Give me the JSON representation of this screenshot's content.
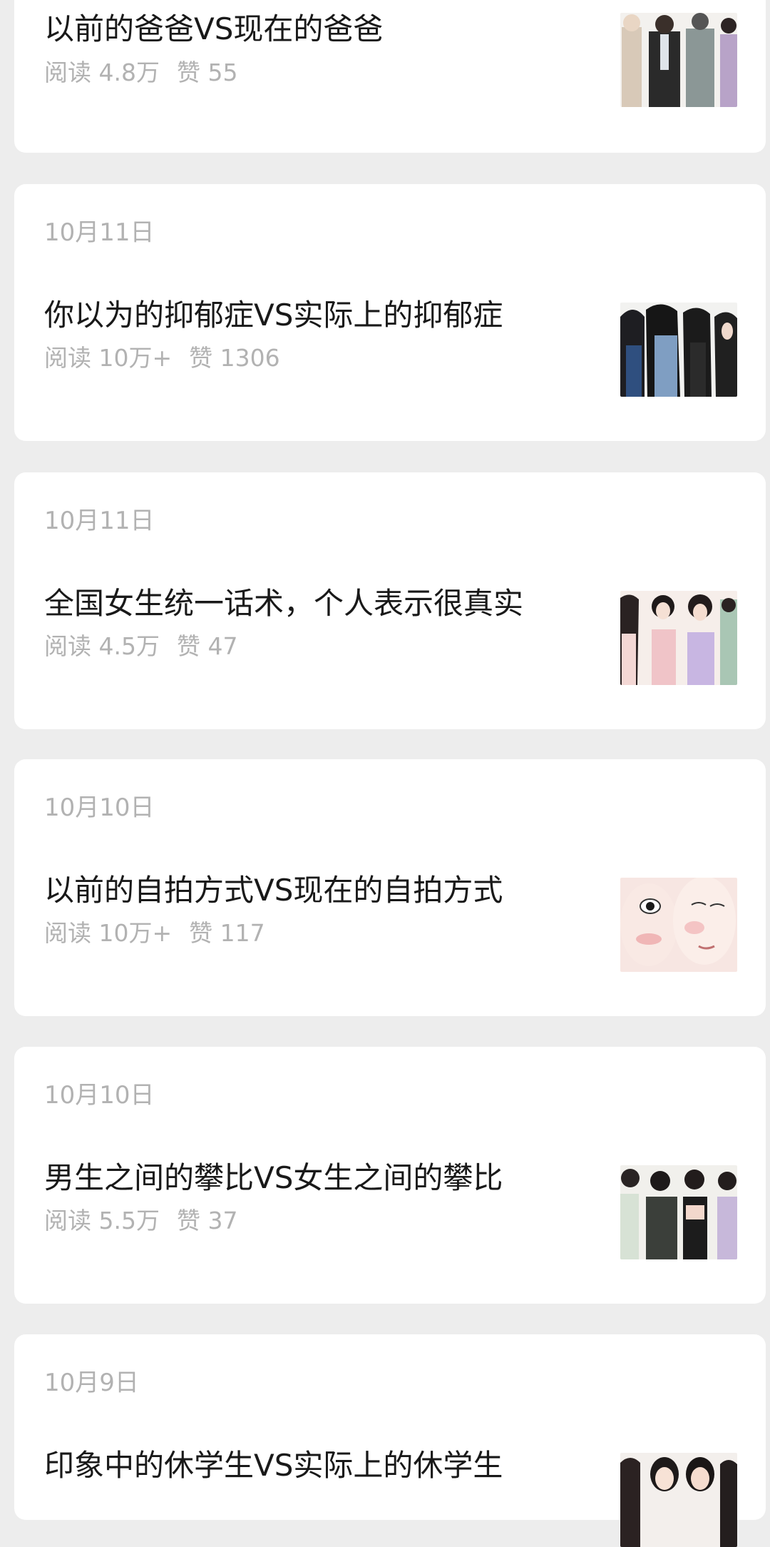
{
  "articles": [
    {
      "date": "",
      "title": "以前的爸爸VS现在的爸爸",
      "reads": "阅读 4.8万",
      "likes": "赞 55",
      "thumb_icon": "illustration-fathers-thumbnail"
    },
    {
      "date": "10月11日",
      "title": "你以为的抑郁症VS实际上的抑郁症",
      "reads": "阅读 10万+",
      "likes": "赞 1306",
      "thumb_icon": "illustration-women-dark-hair-thumbnail"
    },
    {
      "date": "10月11日",
      "title": "全国女生统一话术，个人表示很真实",
      "reads": "阅读 4.5万",
      "likes": "赞 47",
      "thumb_icon": "illustration-women-group-thumbnail"
    },
    {
      "date": "10月10日",
      "title": "以前的自拍方式VS现在的自拍方式",
      "reads": "阅读 10万+",
      "likes": "赞 117",
      "thumb_icon": "illustration-selfie-faces-thumbnail"
    },
    {
      "date": "10月10日",
      "title": "男生之间的攀比VS女生之间的攀比",
      "reads": "阅读 5.5万",
      "likes": "赞 37",
      "thumb_icon": "illustration-men-women-thumbnail"
    },
    {
      "date": "10月9日",
      "title": "印象中的休学生VS实际上的休学生",
      "reads": "",
      "likes": "",
      "thumb_icon": "illustration-students-thumbnail"
    }
  ],
  "colors": {
    "background": "#ededed",
    "card": "#ffffff",
    "title": "#191919",
    "secondary": "#b2b2b2",
    "accent": "#07c160"
  }
}
